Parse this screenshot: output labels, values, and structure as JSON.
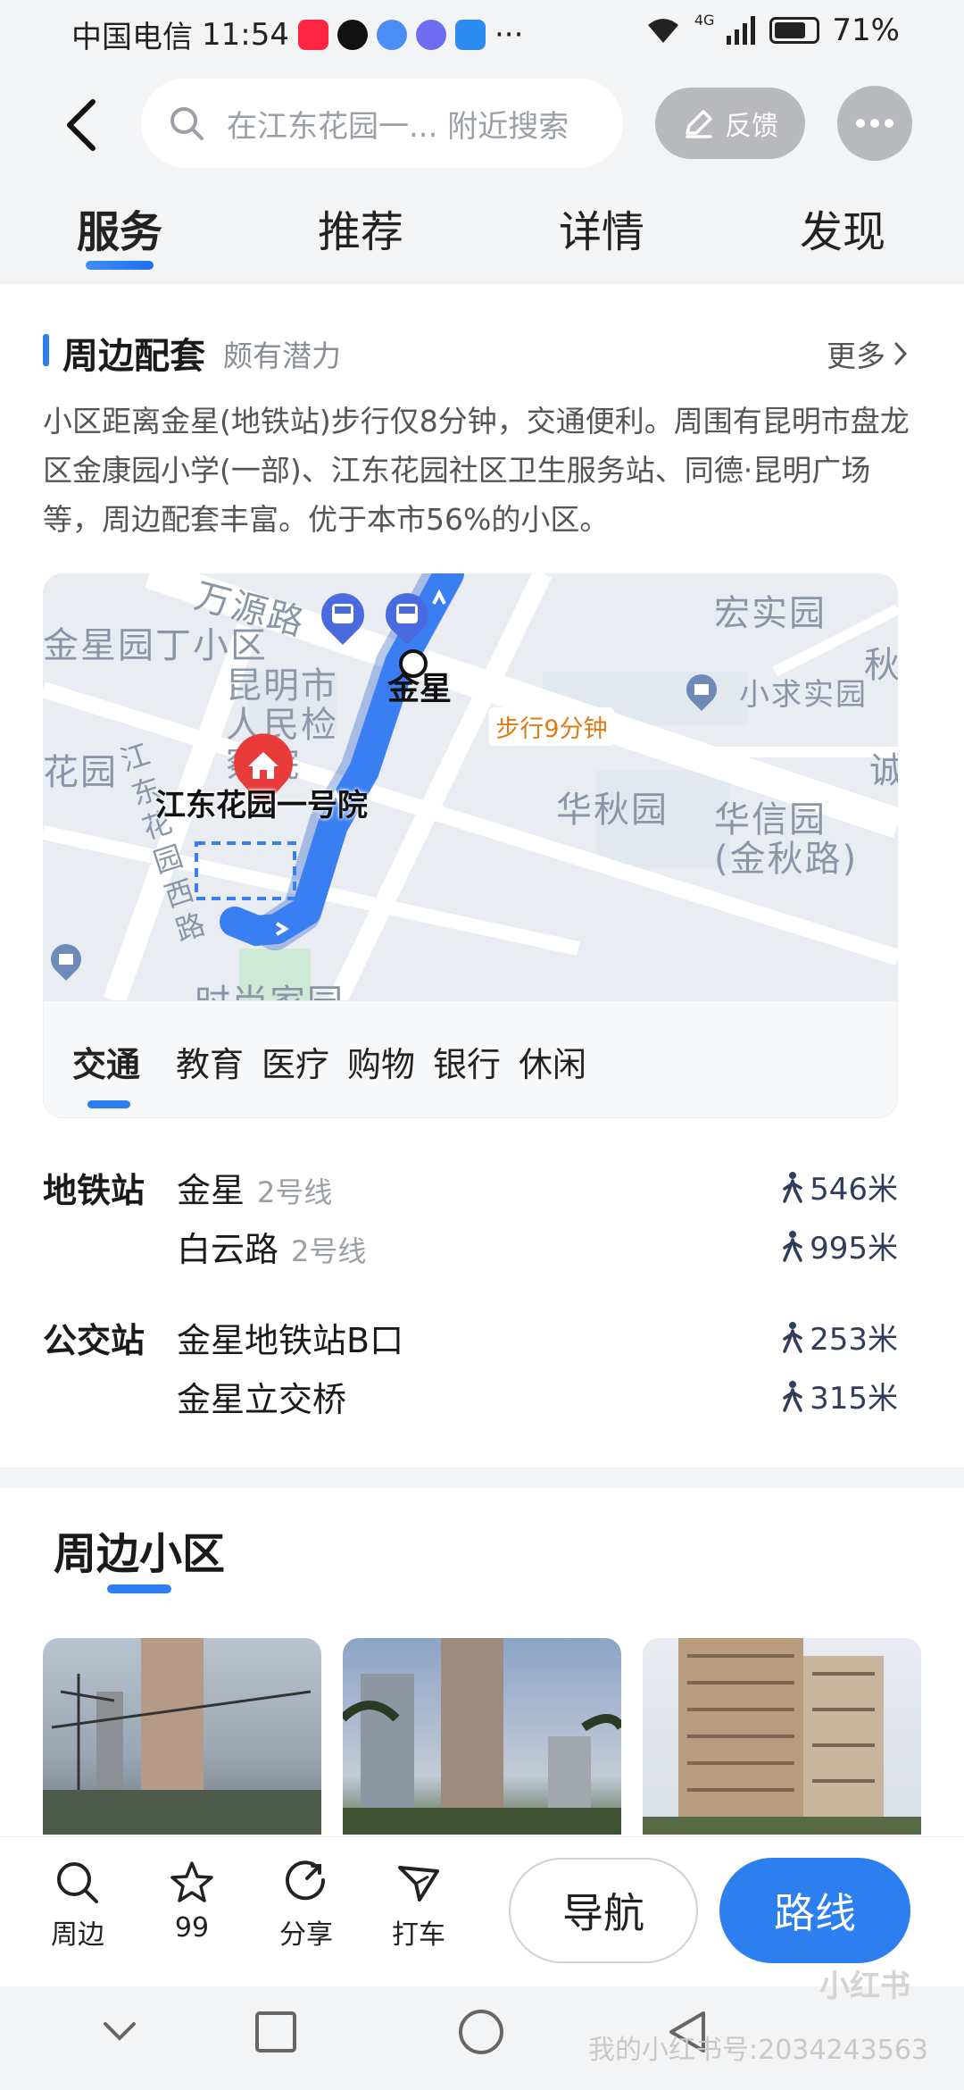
{
  "status_bar": {
    "carrier": "中国电信",
    "time": "11:54",
    "network": "4G",
    "battery": "71%",
    "dots": "···"
  },
  "header": {
    "search_placeholder": "在江东花园一... 附近搜索",
    "feedback_label": "反馈"
  },
  "tabs": [
    "服务",
    "推荐",
    "详情",
    "发现"
  ],
  "surroundings": {
    "title": "周边配套",
    "subtitle": "颇有潜力",
    "more_label": "更多",
    "description": "小区距离金星(地铁站)步行仅8分钟，交通便利。周围有昆明市盘龙区金康园小学(一部)、江东花园社区卫生服务站、同德·昆明广场等，周边配套丰富。优于本市56%的小区。"
  },
  "map": {
    "labels": {
      "road1": "万源路",
      "road2": "江东花园西路",
      "poi1": "金星园丁小区",
      "poi2": "昆明市人民检察院",
      "poi3": "花园",
      "poi4": "宏实园",
      "poi5": "秋",
      "poi6": "小求实园",
      "poi7": "华秋园",
      "poi8": "华信园(金秋路)",
      "poi9": "诚",
      "poi10": "时尚家园"
    },
    "station_name": "金星",
    "walk_text": "步行9分钟",
    "home_label": "江东花园一号院",
    "route_color": "#3a7ff2"
  },
  "categories": [
    "交通",
    "教育",
    "医疗",
    "购物",
    "银行",
    "休闲"
  ],
  "transit": {
    "metro_label": "地铁站",
    "metro": [
      {
        "name": "金星",
        "line": "2号线",
        "distance": "546米"
      },
      {
        "name": "白云路",
        "line": "2号线",
        "distance": "995米"
      }
    ],
    "bus_label": "公交站",
    "bus": [
      {
        "name": "金星地铁站B口",
        "distance": "253米"
      },
      {
        "name": "金星立交桥",
        "distance": "315米"
      }
    ]
  },
  "nearby": {
    "title": "周边小区"
  },
  "bottom_bar": {
    "nearby": "周边",
    "favorites": "99",
    "share": "分享",
    "taxi": "打车",
    "navigate": "导航",
    "route": "路线"
  },
  "watermark": {
    "logo": "小红书",
    "user": "我的小红书号:2034243563"
  },
  "colors": {
    "accent": "#2d7ff0"
  }
}
